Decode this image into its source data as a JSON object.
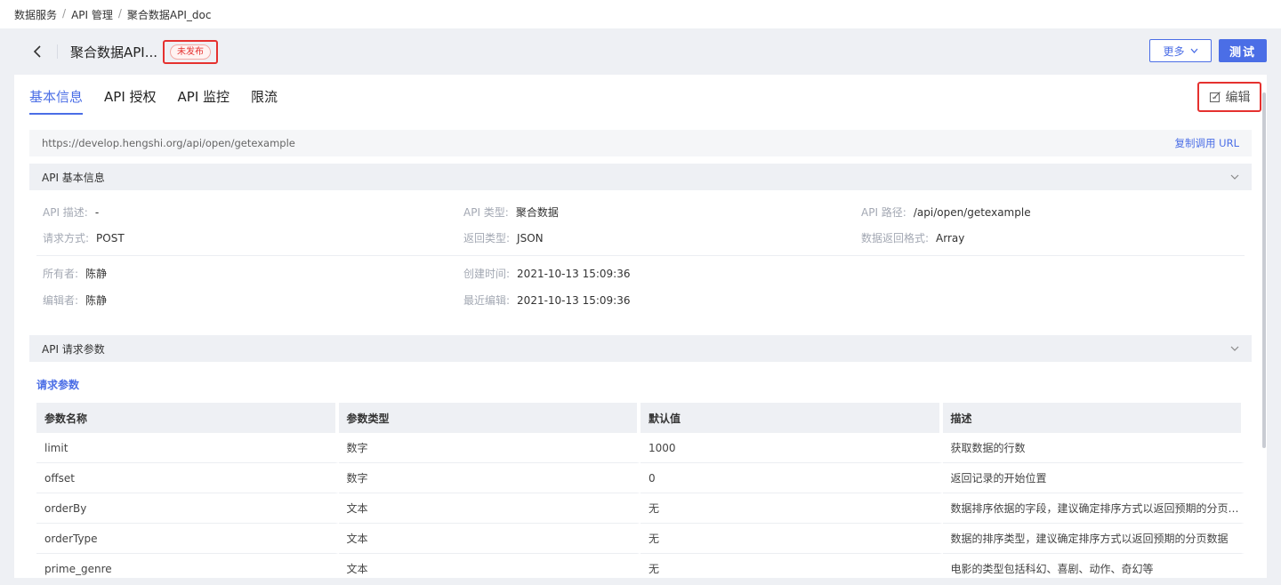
{
  "breadcrumb": {
    "items": [
      "数据服务",
      "API 管理",
      "聚合数据API_doc"
    ],
    "sep": "/"
  },
  "header": {
    "title": "聚合数据API...",
    "status": "未发布",
    "more_label": "更多",
    "test_label": "测试"
  },
  "tabs": [
    {
      "label": "基本信息"
    },
    {
      "label": "API 授权"
    },
    {
      "label": "API 监控"
    },
    {
      "label": "限流"
    }
  ],
  "edit_label": "编辑",
  "url": {
    "value": "https://develop.hengshi.org/api/open/getexample",
    "copy_label": "复制调用 URL"
  },
  "basic_info": {
    "title": "API 基本信息",
    "rows": [
      [
        {
          "label": "API 描述:",
          "value": "-"
        },
        {
          "label": "API 类型:",
          "value": "聚合数据"
        },
        {
          "label": "API 路径:",
          "value": "/api/open/getexample"
        }
      ],
      [
        {
          "label": "请求方式:",
          "value": "POST"
        },
        {
          "label": "返回类型:",
          "value": "JSON"
        },
        {
          "label": "数据返回格式:",
          "value": "Array"
        }
      ],
      [
        {
          "label": "所有者:",
          "value": "陈静"
        },
        {
          "label": "创建时间:",
          "value": "2021-10-13 15:09:36"
        }
      ],
      [
        {
          "label": "编辑者:",
          "value": "陈静"
        },
        {
          "label": "最近编辑:",
          "value": "2021-10-13 15:09:36"
        }
      ]
    ]
  },
  "request_params": {
    "section_title": "API 请求参数",
    "sub_title": "请求参数",
    "columns": [
      "参数名称",
      "参数类型",
      "默认值",
      "描述"
    ],
    "rows": [
      [
        "limit",
        "数字",
        "1000",
        "获取数据的行数"
      ],
      [
        "offset",
        "数字",
        "0",
        "返回记录的开始位置"
      ],
      [
        "orderBy",
        "文本",
        "无",
        "数据排序依据的字段，建议确定排序方式以返回预期的分页数..."
      ],
      [
        "orderType",
        "文本",
        "无",
        "数据的排序类型，建议确定排序方式以返回预期的分页数据"
      ],
      [
        "prime_genre",
        "文本",
        "无",
        "电影的类型包括科幻、喜剧、动作、奇幻等"
      ]
    ]
  }
}
